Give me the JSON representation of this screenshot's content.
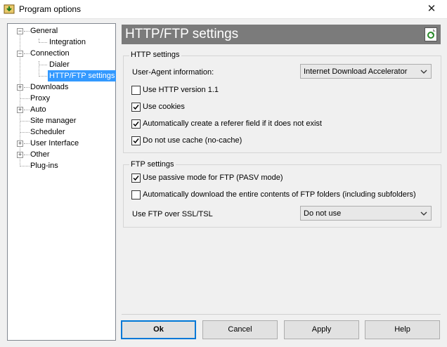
{
  "window": {
    "title": "Program options",
    "icon": "program-options-icon",
    "close_label": "✕"
  },
  "tree": {
    "nodes": [
      {
        "label": "General",
        "expander": "−"
      },
      {
        "label": "Integration"
      },
      {
        "label": "Connection",
        "expander": "−"
      },
      {
        "label": "Dialer"
      },
      {
        "label": "HTTP/FTP settings",
        "selected": true
      },
      {
        "label": "Downloads",
        "expander": "+"
      },
      {
        "label": "Proxy"
      },
      {
        "label": "Auto",
        "expander": "+"
      },
      {
        "label": "Site manager"
      },
      {
        "label": "Scheduler"
      },
      {
        "label": "User Interface",
        "expander": "+"
      },
      {
        "label": "Other",
        "expander": "+"
      },
      {
        "label": "Plug-ins"
      }
    ]
  },
  "header": {
    "title": "HTTP/FTP settings",
    "icon": "refresh-page-icon"
  },
  "http": {
    "legend": "HTTP settings",
    "user_agent_label": "User-Agent information:",
    "user_agent_value": "Internet Download Accelerator",
    "checks": [
      {
        "label": "Use HTTP version 1.1",
        "checked": false
      },
      {
        "label": "Use cookies",
        "checked": true
      },
      {
        "label": "Automatically create a referer field if it does not exist",
        "checked": true
      },
      {
        "label": "Do not use cache (no-cache)",
        "checked": true
      }
    ]
  },
  "ftp": {
    "legend": "FTP settings",
    "checks": [
      {
        "label": "Use passive mode for FTP (PASV mode)",
        "checked": true
      },
      {
        "label": "Automatically download the entire contents of FTP folders (including subfolders)",
        "checked": false
      }
    ],
    "ssl_label": "Use FTP over SSL/TSL",
    "ssl_value": "Do not use"
  },
  "buttons": {
    "ok": "Ok",
    "cancel": "Cancel",
    "apply": "Apply",
    "help": "Help"
  },
  "colors": {
    "selection": "#3399ff",
    "header_bg": "#7b7b7b",
    "default_button_border": "#0078d7"
  }
}
